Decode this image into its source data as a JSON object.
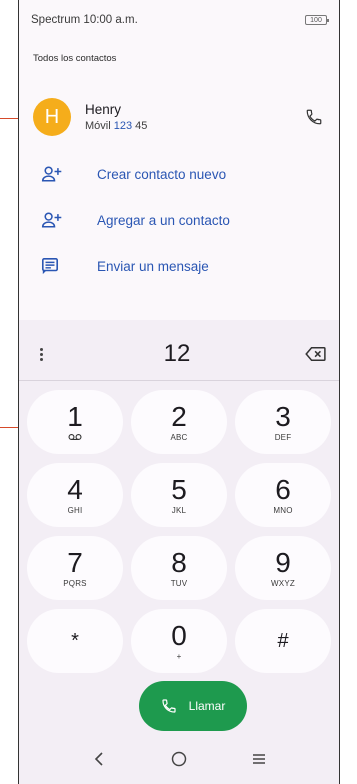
{
  "status_bar": {
    "carrier": "Spectrum",
    "time": "10:00 a.m.",
    "battery": "100"
  },
  "section_title": "Todos los contactos",
  "contact": {
    "initial": "H",
    "name": "Henry",
    "type": "Móvil",
    "number_match": "123",
    "number_rest": " 45",
    "avatar_color": "#f5ad1b"
  },
  "actions": [
    {
      "label": "Crear contacto nuevo",
      "icon": "add-person-icon"
    },
    {
      "label": "Agregar a un contacto",
      "icon": "add-person-icon"
    },
    {
      "label": "Enviar un mensaje",
      "icon": "message-icon"
    }
  ],
  "dialer": {
    "digits": "12",
    "keys": [
      {
        "num": "1",
        "letters": ""
      },
      {
        "num": "2",
        "letters": "ABC"
      },
      {
        "num": "3",
        "letters": "DEF"
      },
      {
        "num": "4",
        "letters": "GHI"
      },
      {
        "num": "5",
        "letters": "JKL"
      },
      {
        "num": "6",
        "letters": "MNO"
      },
      {
        "num": "7",
        "letters": "PQRS"
      },
      {
        "num": "8",
        "letters": "TUV"
      },
      {
        "num": "9",
        "letters": "WXYZ"
      },
      {
        "num": "*",
        "letters": ""
      },
      {
        "num": "0",
        "letters": "+"
      },
      {
        "num": "#",
        "letters": ""
      }
    ],
    "call_label": "Llamar",
    "call_color": "#1e9a4e"
  },
  "colors": {
    "accent": "#2a56b3",
    "callout": "#d64a2a"
  }
}
